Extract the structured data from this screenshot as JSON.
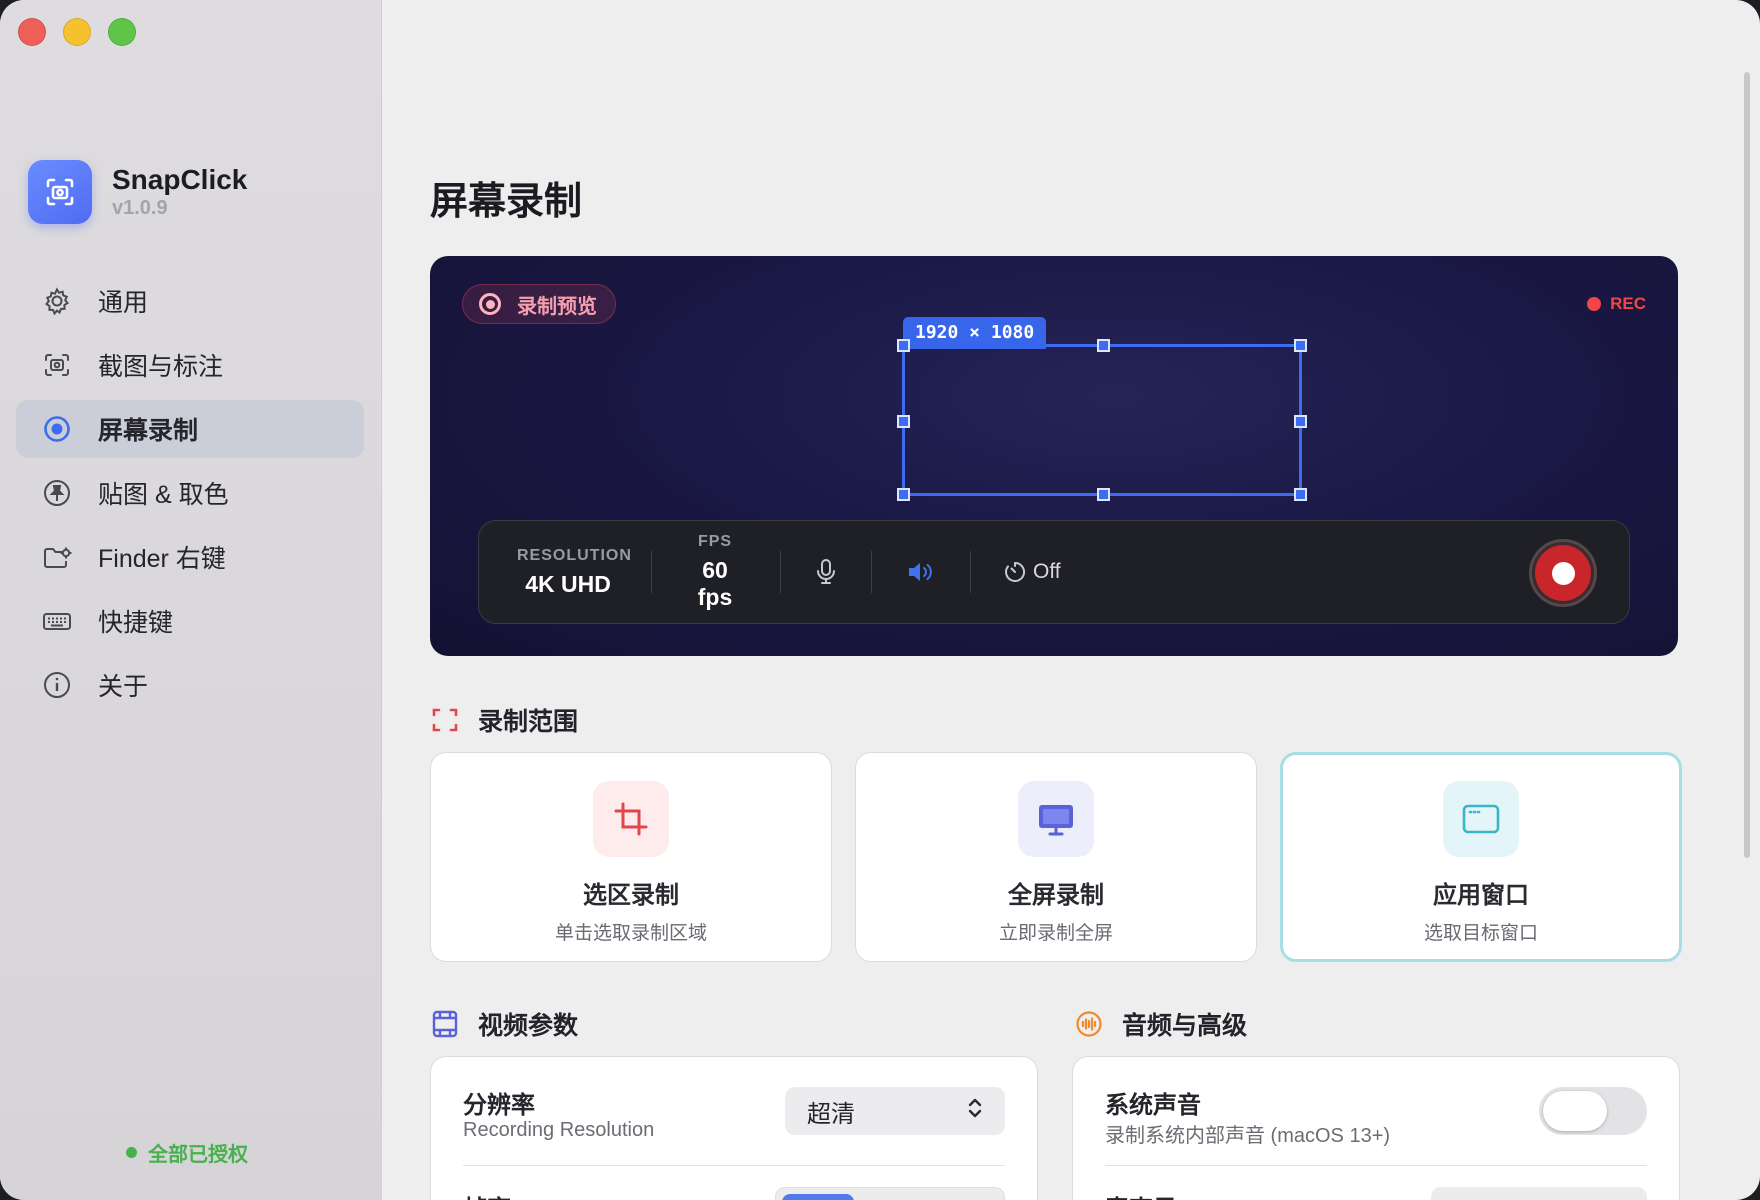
{
  "app": {
    "name": "SnapClick",
    "version": "v1.0.9"
  },
  "sidebar": {
    "items": [
      {
        "label": "通用",
        "icon": "gear-icon"
      },
      {
        "label": "截图与标注",
        "icon": "screenshot-icon"
      },
      {
        "label": "屏幕录制",
        "icon": "record-icon"
      },
      {
        "label": "贴图 & 取色",
        "icon": "pin-icon"
      },
      {
        "label": "Finder 右键",
        "icon": "folder-gear-icon"
      },
      {
        "label": "快捷键",
        "icon": "keyboard-icon"
      },
      {
        "label": "关于",
        "icon": "info-icon"
      }
    ],
    "active_index": 2,
    "auth_status": "全部已授权"
  },
  "page": {
    "title": "屏幕录制"
  },
  "preview": {
    "chip_label": "录制预览",
    "rec_label": "REC",
    "selection_size": "1920 × 1080",
    "controls": {
      "resolution_key": "RESOLUTION",
      "resolution_value": "4K UHD",
      "fps_key": "FPS",
      "fps_value": "60 fps",
      "timer_value": "Off"
    }
  },
  "range_section": {
    "title": "录制范围",
    "modes": [
      {
        "title": "选区录制",
        "subtitle": "单击选取录制区域",
        "icon": "crop-icon",
        "color": "#e0474c"
      },
      {
        "title": "全屏录制",
        "subtitle": "立即录制全屏",
        "icon": "monitor-icon",
        "color": "#5b62d8"
      },
      {
        "title": "应用窗口",
        "subtitle": "选取目标窗口",
        "icon": "window-icon",
        "color": "#3ab5c7"
      }
    ],
    "active_mode": 2
  },
  "video_section": {
    "title": "视频参数",
    "resolution_title": "分辨率",
    "resolution_sub": "Recording Resolution",
    "resolution_value": "超清",
    "framerate_title": "帧率"
  },
  "audio_section": {
    "title": "音频与高级",
    "system_audio_title": "系统声音",
    "system_audio_sub": "录制系统内部声音 (macOS 13+)",
    "system_audio_on": false,
    "mic_title": "麦克风"
  },
  "colors": {
    "accent": "#3c6cf0",
    "rec_red": "#f24545",
    "auth_green": "#46b14d"
  }
}
